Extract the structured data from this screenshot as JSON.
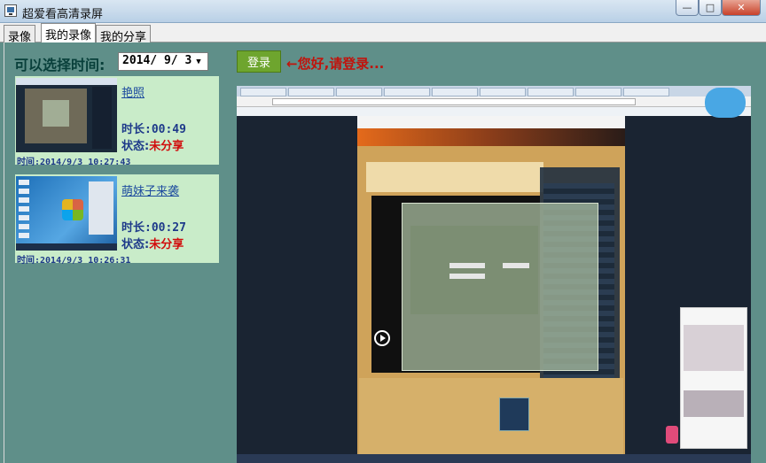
{
  "window": {
    "title": "超爱看高清录屏",
    "controls": {
      "minimize": "—",
      "maximize": "□",
      "close": "✕"
    }
  },
  "tabs": [
    {
      "label": "录像",
      "active": false
    },
    {
      "label": "我的录像",
      "active": true
    },
    {
      "label": "我的分享",
      "active": false
    }
  ],
  "filter": {
    "label": "可以选择时间:",
    "date_value": "2014/ 9/ 3",
    "dropdown_icon": "chevron-down-icon"
  },
  "login": {
    "button_label": "登录",
    "hint": "←您好,请登录..."
  },
  "recordings": [
    {
      "name": "艳照",
      "duration": "时长:00:49",
      "status_label": "状态:",
      "status_value": "未分享",
      "time": "时间:2014/9/3 10:27:43"
    },
    {
      "name": "萌妹子来袭",
      "duration": "时长:00:27",
      "status_label": "状态:",
      "status_value": "未分享",
      "time": "时间:2014/9/3 10:26:31"
    }
  ],
  "colors": {
    "panel_bg": "#5f8f89",
    "card_bg": "#c9ecc9",
    "login_button": "#6ea52e",
    "hint_text": "#c0140d",
    "status_unshared": "#d10d0d"
  }
}
